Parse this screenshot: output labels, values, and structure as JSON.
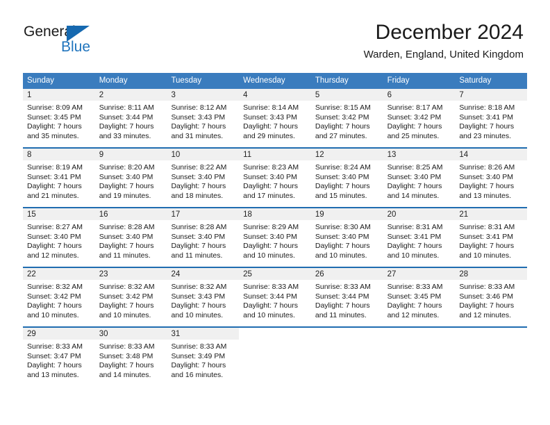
{
  "brand": {
    "name_part1": "General",
    "name_part2": "Blue",
    "logo_icon": "triangle-logo-icon",
    "accent_color": "#1669b0"
  },
  "header": {
    "title": "December 2024",
    "subtitle": "Warden, England, United Kingdom"
  },
  "calendar": {
    "header_bg": "#3a7cbe",
    "row_divider_color": "#1f6cb0",
    "day_number_bg": "#f0f0f0",
    "weekdays": [
      "Sunday",
      "Monday",
      "Tuesday",
      "Wednesday",
      "Thursday",
      "Friday",
      "Saturday"
    ],
    "weeks": [
      [
        {
          "day": "1",
          "sunrise": "Sunrise: 8:09 AM",
          "sunset": "Sunset: 3:45 PM",
          "daylight_line1": "Daylight: 7 hours",
          "daylight_line2": "and 35 minutes."
        },
        {
          "day": "2",
          "sunrise": "Sunrise: 8:11 AM",
          "sunset": "Sunset: 3:44 PM",
          "daylight_line1": "Daylight: 7 hours",
          "daylight_line2": "and 33 minutes."
        },
        {
          "day": "3",
          "sunrise": "Sunrise: 8:12 AM",
          "sunset": "Sunset: 3:43 PM",
          "daylight_line1": "Daylight: 7 hours",
          "daylight_line2": "and 31 minutes."
        },
        {
          "day": "4",
          "sunrise": "Sunrise: 8:14 AM",
          "sunset": "Sunset: 3:43 PM",
          "daylight_line1": "Daylight: 7 hours",
          "daylight_line2": "and 29 minutes."
        },
        {
          "day": "5",
          "sunrise": "Sunrise: 8:15 AM",
          "sunset": "Sunset: 3:42 PM",
          "daylight_line1": "Daylight: 7 hours",
          "daylight_line2": "and 27 minutes."
        },
        {
          "day": "6",
          "sunrise": "Sunrise: 8:17 AM",
          "sunset": "Sunset: 3:42 PM",
          "daylight_line1": "Daylight: 7 hours",
          "daylight_line2": "and 25 minutes."
        },
        {
          "day": "7",
          "sunrise": "Sunrise: 8:18 AM",
          "sunset": "Sunset: 3:41 PM",
          "daylight_line1": "Daylight: 7 hours",
          "daylight_line2": "and 23 minutes."
        }
      ],
      [
        {
          "day": "8",
          "sunrise": "Sunrise: 8:19 AM",
          "sunset": "Sunset: 3:41 PM",
          "daylight_line1": "Daylight: 7 hours",
          "daylight_line2": "and 21 minutes."
        },
        {
          "day": "9",
          "sunrise": "Sunrise: 8:20 AM",
          "sunset": "Sunset: 3:40 PM",
          "daylight_line1": "Daylight: 7 hours",
          "daylight_line2": "and 19 minutes."
        },
        {
          "day": "10",
          "sunrise": "Sunrise: 8:22 AM",
          "sunset": "Sunset: 3:40 PM",
          "daylight_line1": "Daylight: 7 hours",
          "daylight_line2": "and 18 minutes."
        },
        {
          "day": "11",
          "sunrise": "Sunrise: 8:23 AM",
          "sunset": "Sunset: 3:40 PM",
          "daylight_line1": "Daylight: 7 hours",
          "daylight_line2": "and 17 minutes."
        },
        {
          "day": "12",
          "sunrise": "Sunrise: 8:24 AM",
          "sunset": "Sunset: 3:40 PM",
          "daylight_line1": "Daylight: 7 hours",
          "daylight_line2": "and 15 minutes."
        },
        {
          "day": "13",
          "sunrise": "Sunrise: 8:25 AM",
          "sunset": "Sunset: 3:40 PM",
          "daylight_line1": "Daylight: 7 hours",
          "daylight_line2": "and 14 minutes."
        },
        {
          "day": "14",
          "sunrise": "Sunrise: 8:26 AM",
          "sunset": "Sunset: 3:40 PM",
          "daylight_line1": "Daylight: 7 hours",
          "daylight_line2": "and 13 minutes."
        }
      ],
      [
        {
          "day": "15",
          "sunrise": "Sunrise: 8:27 AM",
          "sunset": "Sunset: 3:40 PM",
          "daylight_line1": "Daylight: 7 hours",
          "daylight_line2": "and 12 minutes."
        },
        {
          "day": "16",
          "sunrise": "Sunrise: 8:28 AM",
          "sunset": "Sunset: 3:40 PM",
          "daylight_line1": "Daylight: 7 hours",
          "daylight_line2": "and 11 minutes."
        },
        {
          "day": "17",
          "sunrise": "Sunrise: 8:28 AM",
          "sunset": "Sunset: 3:40 PM",
          "daylight_line1": "Daylight: 7 hours",
          "daylight_line2": "and 11 minutes."
        },
        {
          "day": "18",
          "sunrise": "Sunrise: 8:29 AM",
          "sunset": "Sunset: 3:40 PM",
          "daylight_line1": "Daylight: 7 hours",
          "daylight_line2": "and 10 minutes."
        },
        {
          "day": "19",
          "sunrise": "Sunrise: 8:30 AM",
          "sunset": "Sunset: 3:40 PM",
          "daylight_line1": "Daylight: 7 hours",
          "daylight_line2": "and 10 minutes."
        },
        {
          "day": "20",
          "sunrise": "Sunrise: 8:31 AM",
          "sunset": "Sunset: 3:41 PM",
          "daylight_line1": "Daylight: 7 hours",
          "daylight_line2": "and 10 minutes."
        },
        {
          "day": "21",
          "sunrise": "Sunrise: 8:31 AM",
          "sunset": "Sunset: 3:41 PM",
          "daylight_line1": "Daylight: 7 hours",
          "daylight_line2": "and 10 minutes."
        }
      ],
      [
        {
          "day": "22",
          "sunrise": "Sunrise: 8:32 AM",
          "sunset": "Sunset: 3:42 PM",
          "daylight_line1": "Daylight: 7 hours",
          "daylight_line2": "and 10 minutes."
        },
        {
          "day": "23",
          "sunrise": "Sunrise: 8:32 AM",
          "sunset": "Sunset: 3:42 PM",
          "daylight_line1": "Daylight: 7 hours",
          "daylight_line2": "and 10 minutes."
        },
        {
          "day": "24",
          "sunrise": "Sunrise: 8:32 AM",
          "sunset": "Sunset: 3:43 PM",
          "daylight_line1": "Daylight: 7 hours",
          "daylight_line2": "and 10 minutes."
        },
        {
          "day": "25",
          "sunrise": "Sunrise: 8:33 AM",
          "sunset": "Sunset: 3:44 PM",
          "daylight_line1": "Daylight: 7 hours",
          "daylight_line2": "and 10 minutes."
        },
        {
          "day": "26",
          "sunrise": "Sunrise: 8:33 AM",
          "sunset": "Sunset: 3:44 PM",
          "daylight_line1": "Daylight: 7 hours",
          "daylight_line2": "and 11 minutes."
        },
        {
          "day": "27",
          "sunrise": "Sunrise: 8:33 AM",
          "sunset": "Sunset: 3:45 PM",
          "daylight_line1": "Daylight: 7 hours",
          "daylight_line2": "and 12 minutes."
        },
        {
          "day": "28",
          "sunrise": "Sunrise: 8:33 AM",
          "sunset": "Sunset: 3:46 PM",
          "daylight_line1": "Daylight: 7 hours",
          "daylight_line2": "and 12 minutes."
        }
      ],
      [
        {
          "day": "29",
          "sunrise": "Sunrise: 8:33 AM",
          "sunset": "Sunset: 3:47 PM",
          "daylight_line1": "Daylight: 7 hours",
          "daylight_line2": "and 13 minutes."
        },
        {
          "day": "30",
          "sunrise": "Sunrise: 8:33 AM",
          "sunset": "Sunset: 3:48 PM",
          "daylight_line1": "Daylight: 7 hours",
          "daylight_line2": "and 14 minutes."
        },
        {
          "day": "31",
          "sunrise": "Sunrise: 8:33 AM",
          "sunset": "Sunset: 3:49 PM",
          "daylight_line1": "Daylight: 7 hours",
          "daylight_line2": "and 16 minutes."
        },
        {
          "day": "",
          "sunrise": "",
          "sunset": "",
          "daylight_line1": "",
          "daylight_line2": ""
        },
        {
          "day": "",
          "sunrise": "",
          "sunset": "",
          "daylight_line1": "",
          "daylight_line2": ""
        },
        {
          "day": "",
          "sunrise": "",
          "sunset": "",
          "daylight_line1": "",
          "daylight_line2": ""
        },
        {
          "day": "",
          "sunrise": "",
          "sunset": "",
          "daylight_line1": "",
          "daylight_line2": ""
        }
      ]
    ]
  }
}
